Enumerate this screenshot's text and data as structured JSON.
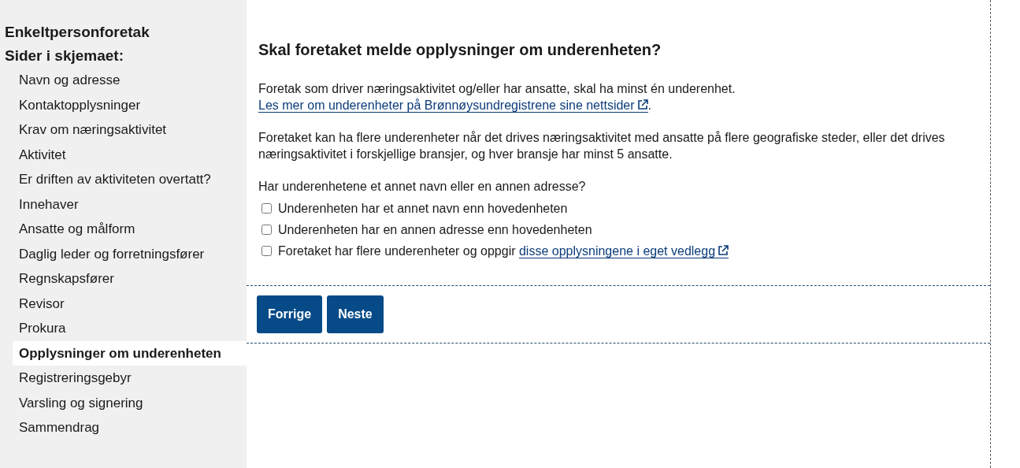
{
  "sidebar": {
    "title": "Enkeltpersonforetak",
    "subtitle": "Sider i skjemaet:",
    "items": [
      {
        "label": "Navn og adresse",
        "selected": false
      },
      {
        "label": "Kontaktopplysninger",
        "selected": false
      },
      {
        "label": "Krav om næringsaktivitet",
        "selected": false
      },
      {
        "label": "Aktivitet",
        "selected": false
      },
      {
        "label": "Er driften av aktiviteten overtatt?",
        "selected": false
      },
      {
        "label": "Innehaver",
        "selected": false
      },
      {
        "label": "Ansatte og målform",
        "selected": false
      },
      {
        "label": "Daglig leder og forretningsfører",
        "selected": false
      },
      {
        "label": "Regnskapsfører",
        "selected": false
      },
      {
        "label": "Revisor",
        "selected": false
      },
      {
        "label": "Prokura",
        "selected": false
      },
      {
        "label": "Opplysninger om underenheten",
        "selected": true
      },
      {
        "label": "Registreringsgebyr",
        "selected": false
      },
      {
        "label": "Varsling og signering",
        "selected": false
      },
      {
        "label": "Sammendrag",
        "selected": false
      }
    ]
  },
  "main": {
    "heading": "Skal foretaket melde opplysninger om underenheten?",
    "paragraphs": [
      {
        "text": "Foretak som driver næringsaktivitet og/eller har ansatte, skal ha minst én underenhet. ",
        "link": "Les mer om underenheter på Brønnøysundregistrene sine nettsider",
        "after": "."
      },
      {
        "text": "Foretaket kan ha flere underenheter når det drives næringsaktivitet med ansatte på flere geografiske steder, eller det drives næringsaktivitet i forskjellige bransjer, og hver bransje har minst 5 ansatte."
      }
    ],
    "question": "Har underenhetene et annet navn eller en annen adresse?",
    "options": [
      {
        "text": "Underenheten har et annet navn enn hovedenheten",
        "checked": false
      },
      {
        "text": "Underenheten har en annen adresse enn hovedenheten",
        "checked": false
      },
      {
        "text": "Foretaket har flere underenheter og oppgir ",
        "link": "disse opplysningene i eget vedlegg",
        "checked": false
      }
    ],
    "buttons": [
      "Forrige",
      "Neste"
    ]
  }
}
